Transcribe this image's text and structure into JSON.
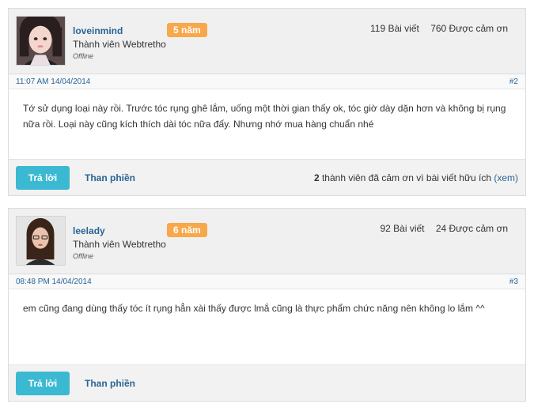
{
  "posts": [
    {
      "username": "loveinmind",
      "badge": "5 năm",
      "user_title": "Thành viên Webtretho",
      "status": "Offline",
      "posts_count": "119 Bài viết",
      "thanks_count": "760 Được cảm ơn",
      "date": "11:07 AM 14/04/2014",
      "post_number": "#2",
      "content": "Tớ sử dụng loại này rồi. Trước tóc rụng ghê lắm, uống một thời gian thấy ok, tóc giờ dày dặn hơn và không bị rụng nữa rồi. Loại này cũng kích thích dài tóc nữa đấy. Nhưng nhớ mua hàng chuẩn nhé",
      "reply_label": "Trả lời",
      "report_label": "Than phiền",
      "thanks_num": "2",
      "thanks_text": " thành viên đã cảm ơn vì bài viết hữu ích ",
      "thanks_link": "(xem)"
    },
    {
      "username": "leelady",
      "badge": "6 năm",
      "user_title": "Thành viên Webtretho",
      "status": "Offline",
      "posts_count": "92 Bài viết",
      "thanks_count": "24 Được cảm ơn",
      "date": "08:48 PM 14/04/2014",
      "post_number": "#3",
      "content": "em cũng đang dùng thấy tóc ít rụng hẳn xài thấy được lmắ cũng là thực phẩm chức năng nên không lo lắm ^^",
      "reply_label": "Trả lời",
      "report_label": "Than phiền"
    }
  ]
}
